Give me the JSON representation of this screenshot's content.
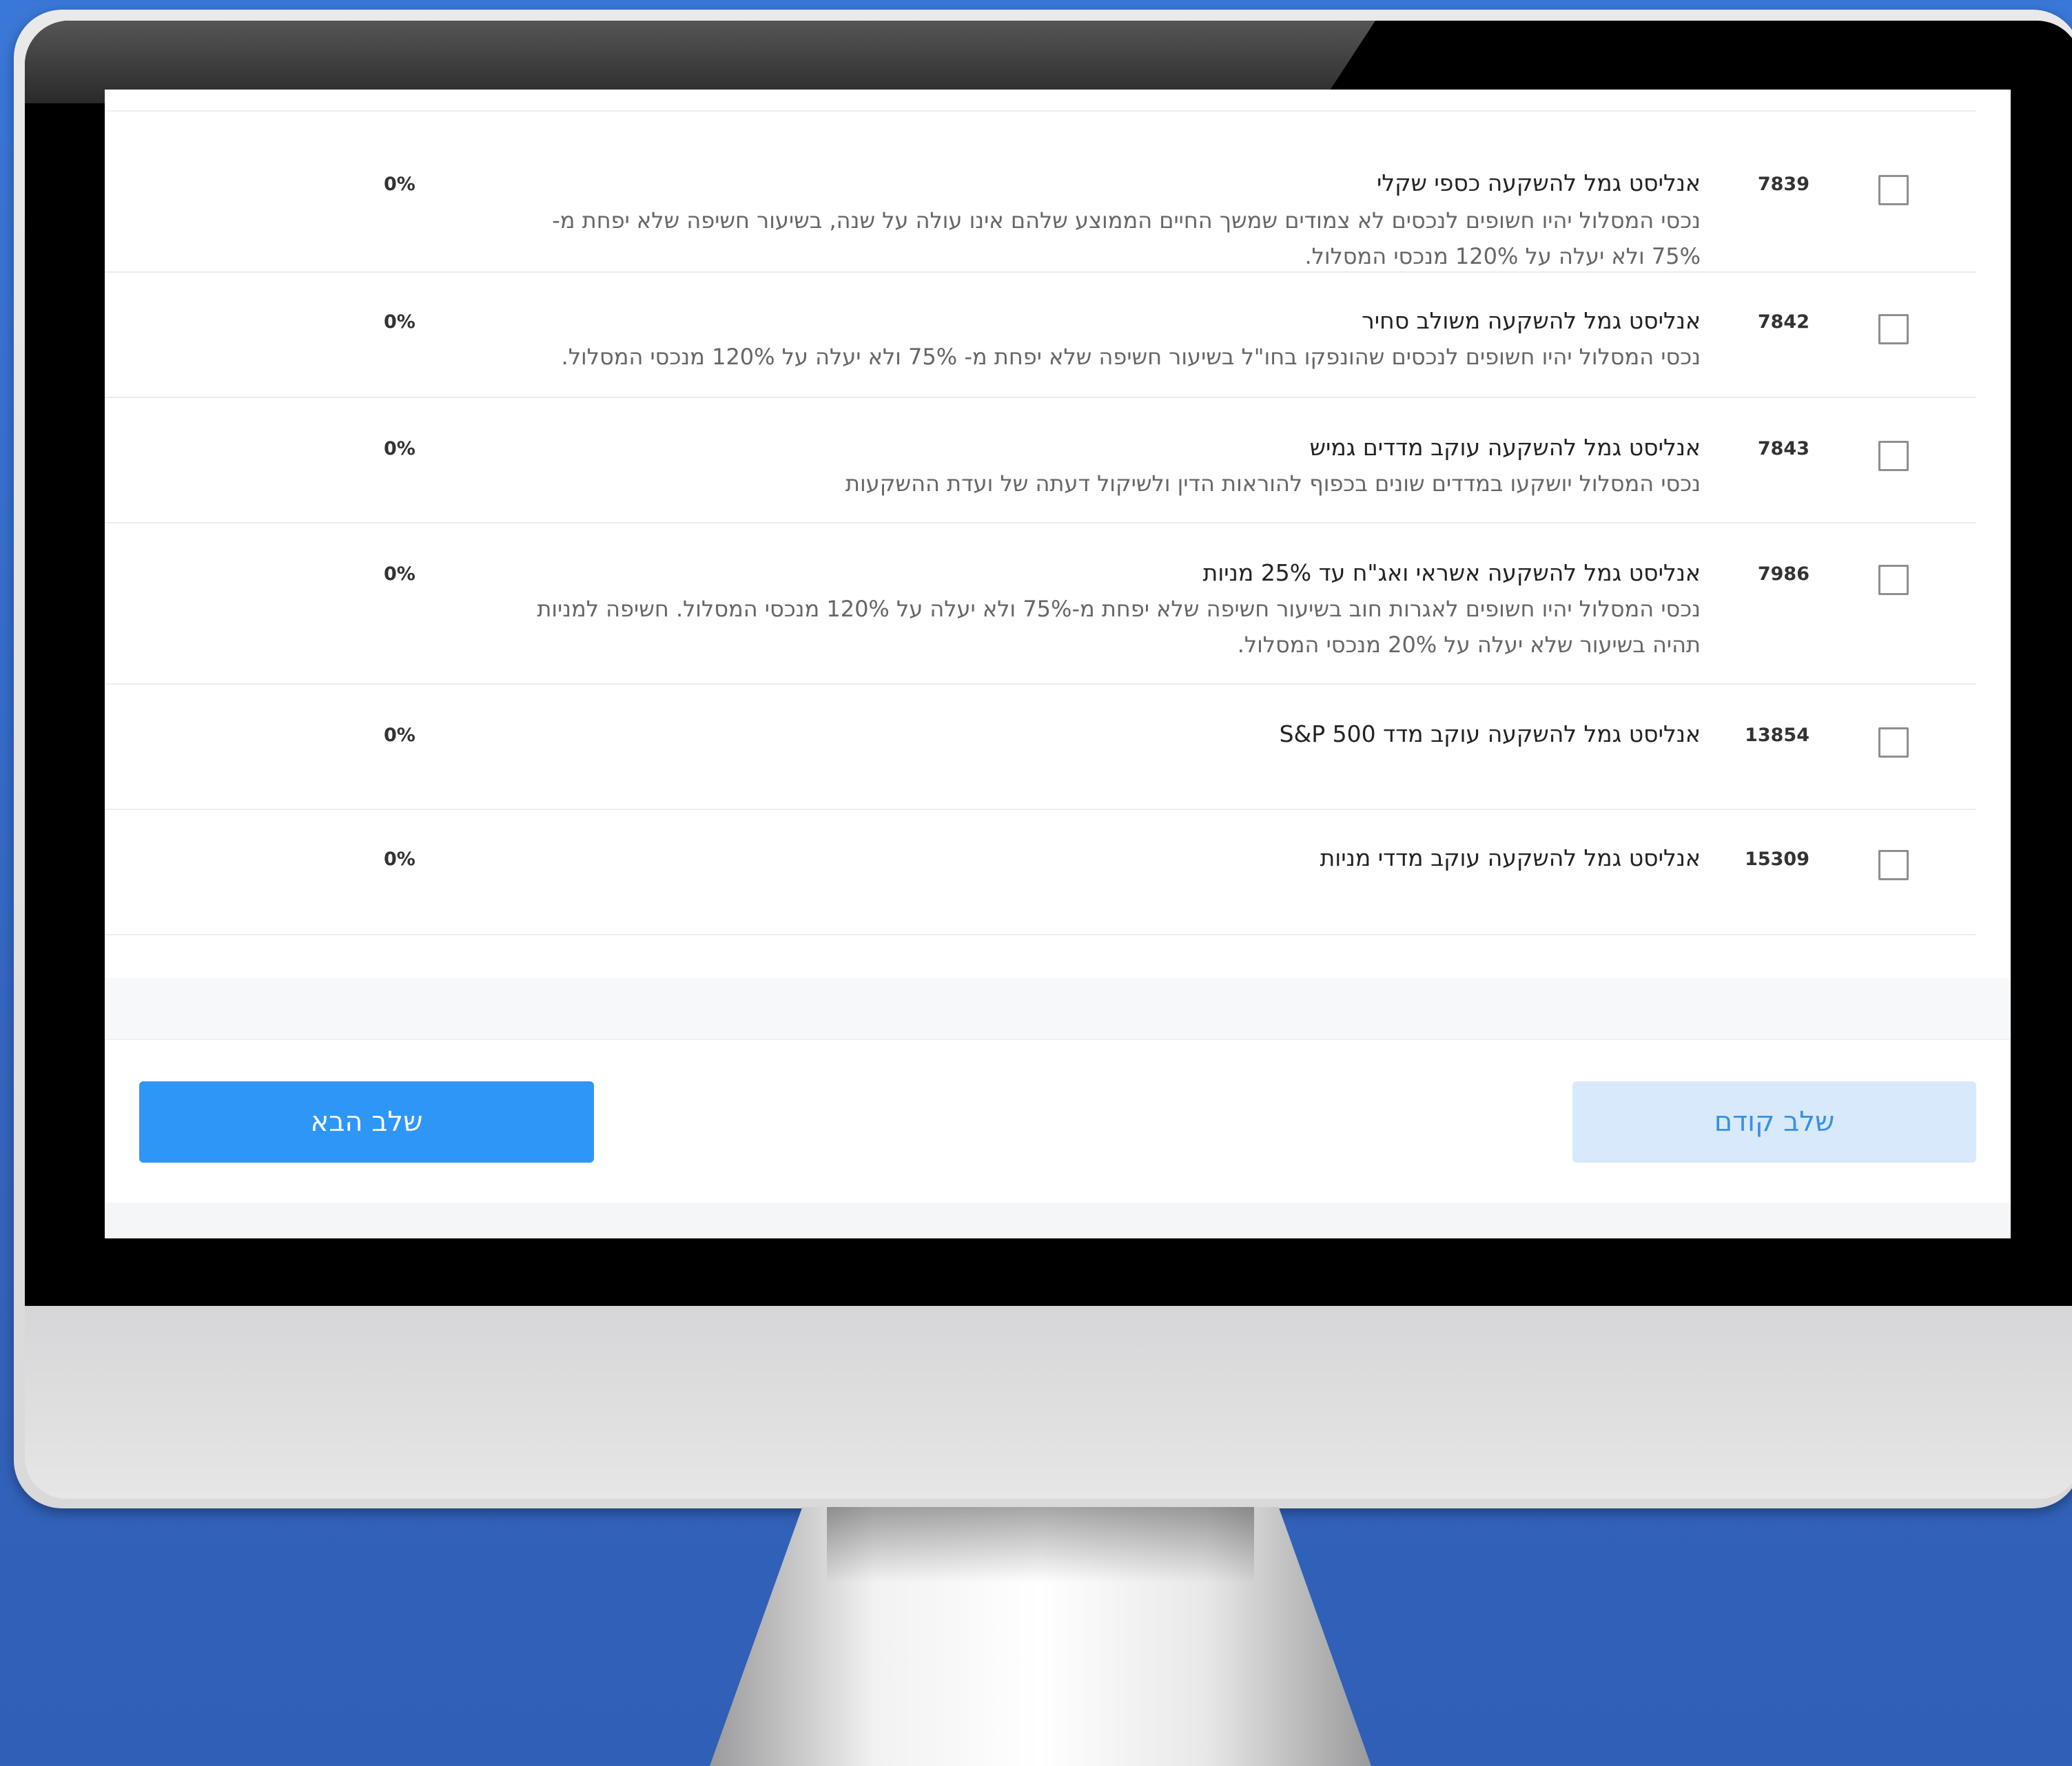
{
  "funds": [
    {
      "code": "7839",
      "title": "אנליסט גמל להשקעה כספי שקלי",
      "description": "נכסי המסלול יהיו חשופים לנכסים לא צמודים שמשך החיים הממוצע שלהם אינו עולה על שנה, בשיעור חשיפה שלא יפחת מ- 75% ולא יעלה על 120% מנכסי המסלול.",
      "percent": "0%"
    },
    {
      "code": "7842",
      "title": "אנליסט גמל להשקעה משולב סחיר",
      "description": "נכסי המסלול יהיו חשופים לנכסים שהונפקו בחו\"ל בשיעור חשיפה שלא יפחת מ- 75% ולא יעלה על 120% מנכסי המסלול.",
      "percent": "0%"
    },
    {
      "code": "7843",
      "title": "אנליסט גמל להשקעה עוקב מדדים גמיש",
      "description": "נכסי המסלול יושקעו במדדים שונים בכפוף להוראות הדין ולשיקול דעתה של ועדת ההשקעות",
      "percent": "0%"
    },
    {
      "code": "7986",
      "title": "אנליסט גמל להשקעה אשראי ואג\"ח עד 25% מניות",
      "description": "נכסי המסלול יהיו חשופים לאגרות חוב בשיעור חשיפה שלא יפחת מ-75% ולא יעלה על 120% מנכסי המסלול. חשיפה למניות תהיה בשיעור שלא יעלה על 20% מנכסי המסלול.",
      "percent": "0%"
    },
    {
      "code": "13854",
      "title": "אנליסט גמל להשקעה עוקב מדד S&P 500",
      "description": "",
      "percent": "0%"
    },
    {
      "code": "15309",
      "title": "אנליסט גמל להשקעה עוקב מדדי מניות",
      "description": "",
      "percent": "0%"
    }
  ],
  "buttons": {
    "next_label": "שלב הבא",
    "prev_label": "שלב קודם"
  },
  "colors": {
    "primary": "#2e96f7",
    "primary_light": "#d7e9fb"
  }
}
